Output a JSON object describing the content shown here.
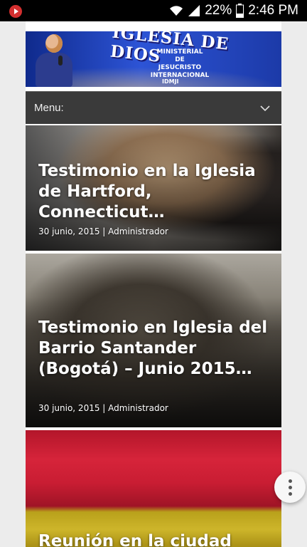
{
  "status_bar": {
    "battery_percent": "22%",
    "time": "2:46 PM",
    "app_icon": "youtube-icon",
    "icons": [
      "wifi-icon",
      "signal-icon",
      "battery-icon"
    ]
  },
  "banner": {
    "title": "IGLESIA DE DIOS",
    "subtitle_lines": [
      "MINISTERIAL",
      "DE",
      "JESUCRISTO",
      "INTERNACIONAL"
    ],
    "short": "IDMJI"
  },
  "menu": {
    "label": "Menu:",
    "icon": "chevron-down-icon"
  },
  "posts": [
    {
      "title": "Testimonio en la Iglesia de Hartford, Connecticut…",
      "meta": "30 junio, 2015 | Administrador"
    },
    {
      "title": "Testimonio en Iglesia del Barrio Santander (Bogotá) – Junio 2015…",
      "meta": "30 junio, 2015 | Administrador"
    },
    {
      "title": "Reunión en la ciudad",
      "meta": ""
    }
  ],
  "fab": {
    "icon": "more-vertical-icon"
  },
  "colors": {
    "menu_bg": "#3a3a3a",
    "banner_blue": "#1c3aa8",
    "page_bg": "#ececec"
  }
}
